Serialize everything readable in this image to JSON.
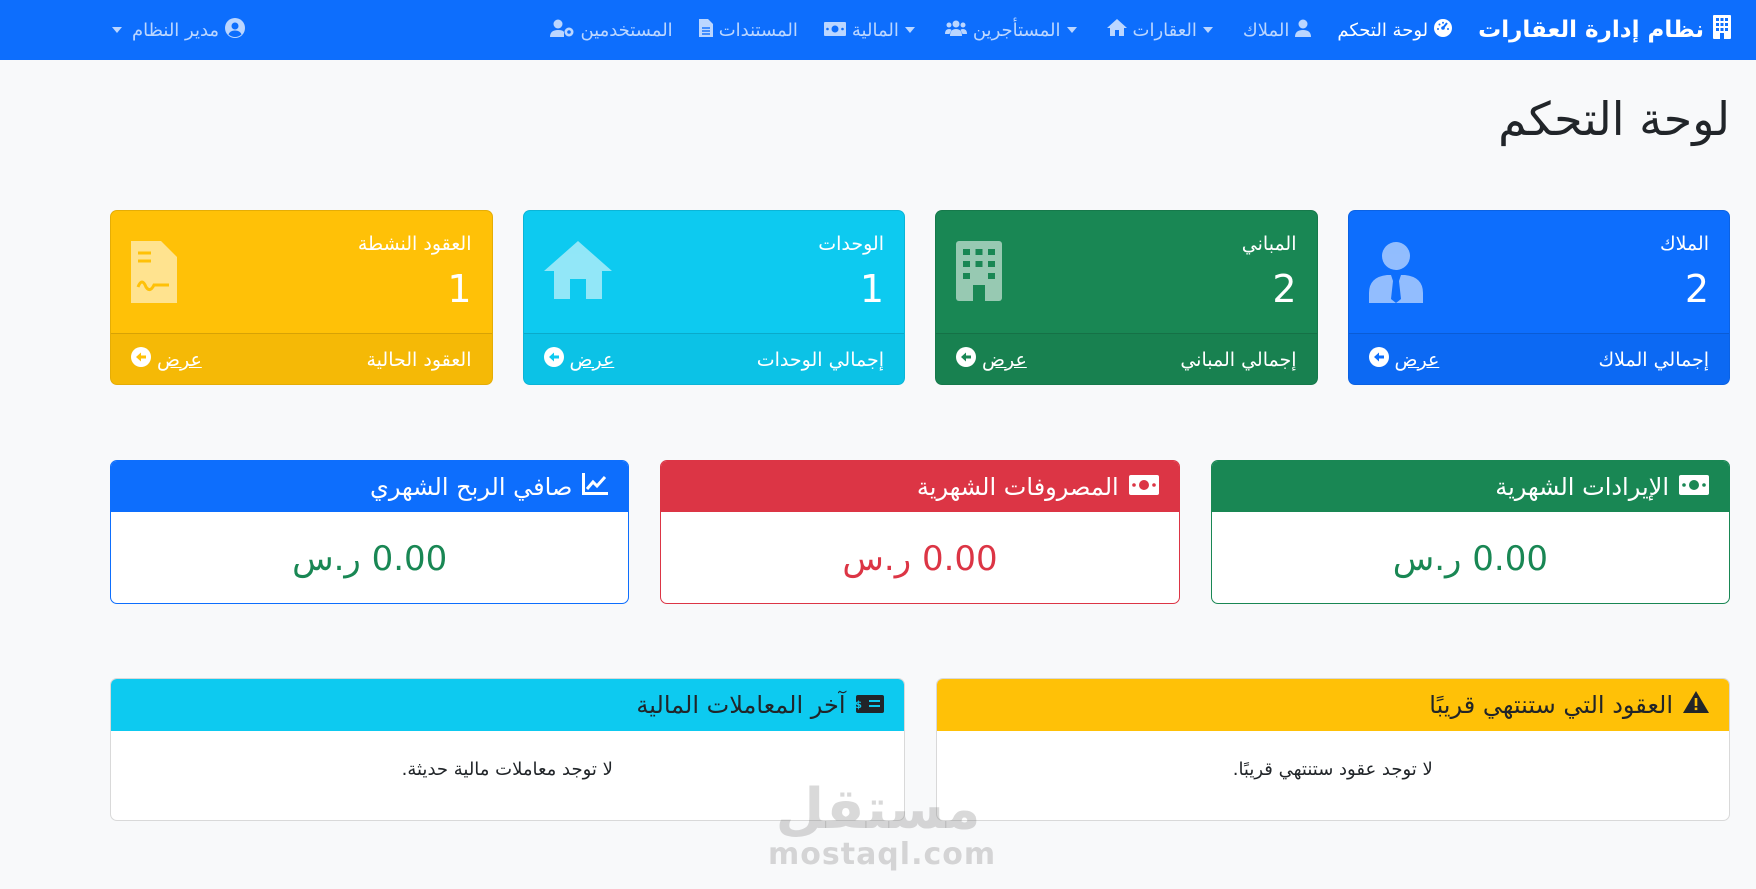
{
  "navbar": {
    "brand": "نظام إدارة العقارات",
    "items": [
      {
        "label": "لوحة التحكم",
        "icon": "gauge-icon",
        "active": true,
        "dropdown": false
      },
      {
        "label": "الملاك",
        "icon": "user-tie-icon",
        "active": false,
        "dropdown": false
      },
      {
        "label": "العقارات",
        "icon": "home-icon",
        "active": false,
        "dropdown": true
      },
      {
        "label": "المستأجرين",
        "icon": "users-icon",
        "active": false,
        "dropdown": true
      },
      {
        "label": "المالية",
        "icon": "money-icon",
        "active": false,
        "dropdown": true
      },
      {
        "label": "المستندات",
        "icon": "file-icon",
        "active": false,
        "dropdown": false
      },
      {
        "label": "المستخدمين",
        "icon": "users-cog-icon",
        "active": false,
        "dropdown": false
      }
    ],
    "user": {
      "label": "مدير النظام",
      "icon": "user-circle-icon",
      "dropdown": true
    }
  },
  "page": {
    "title": "لوحة التحكم"
  },
  "stats": [
    {
      "title": "الملاك",
      "value": "2",
      "footer": "إجمالي الملاك",
      "link": "عرض",
      "color": "#0d6efd",
      "icon": "user-tie-icon"
    },
    {
      "title": "المباني",
      "value": "2",
      "footer": "إجمالي المباني",
      "link": "عرض",
      "color": "#198754",
      "icon": "building-icon"
    },
    {
      "title": "الوحدات",
      "value": "1",
      "footer": "إجمالي الوحدات",
      "link": "عرض",
      "color": "#0dcaf0",
      "icon": "home-icon"
    },
    {
      "title": "العقود النشطة",
      "value": "1",
      "footer": "العقود الحالية",
      "link": "عرض",
      "color": "#ffc107",
      "icon": "file-contract-icon"
    }
  ],
  "money": [
    {
      "title": "الإيرادات الشهرية",
      "amount": "0.00 ر.س",
      "color": "#198754",
      "icon": "money-bill-icon"
    },
    {
      "title": "المصروفات الشهرية",
      "amount": "0.00 ر.س",
      "color": "#dc3545",
      "icon": "money-bill-icon"
    },
    {
      "title": "صافي الربح الشهري",
      "amount": "0.00 ر.س",
      "color": "#0d6efd",
      "icon": "chart-line-icon"
    }
  ],
  "panels": [
    {
      "title": "العقود التي ستنتهي قريبًا",
      "empty": "لا توجد عقود ستنتهي قريبًا.",
      "color": "#ffc107",
      "icon": "warning-icon"
    },
    {
      "title": "آخر المعاملات المالية",
      "empty": "لا توجد معاملات مالية حديثة.",
      "color": "#0dcaf0",
      "icon": "money-check-icon"
    }
  ],
  "watermark": {
    "arabic": "مستقل",
    "latin": "mostaql.com"
  }
}
